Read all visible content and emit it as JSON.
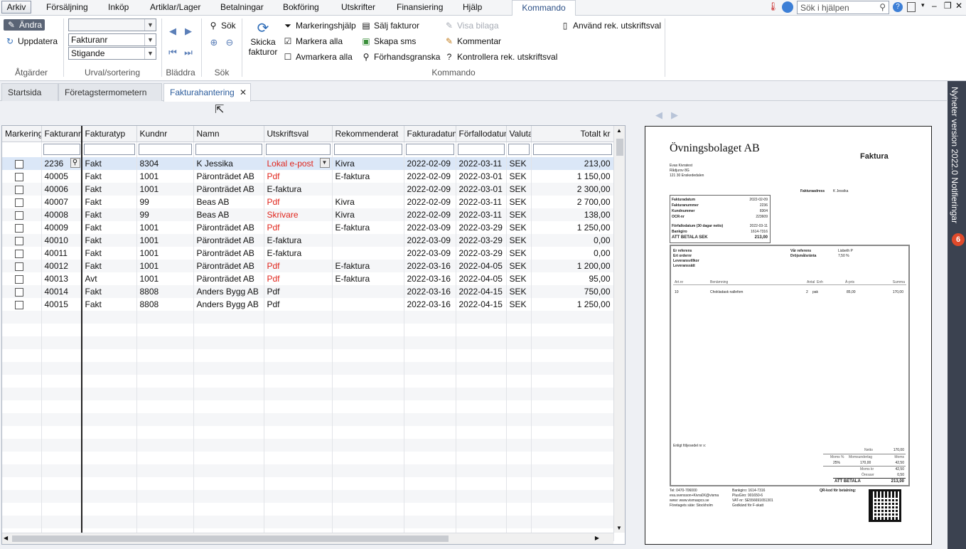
{
  "menubar": {
    "items": [
      "Arkiv",
      "Försäljning",
      "Inköp",
      "Artiklar/Lager",
      "Betalningar",
      "Bokföring",
      "Utskrifter",
      "Finansiering",
      "Hjälp",
      "Kommando"
    ],
    "help_search": "Sök i hjälpen"
  },
  "ribbon": {
    "atgarder": {
      "label": "Åtgärder",
      "andra": "Ändra",
      "uppdatera": "Uppdatera"
    },
    "urval": {
      "label": "Urval/sortering",
      "combo1": "",
      "combo2": "Fakturanr",
      "combo3": "Stigande"
    },
    "bladdra": {
      "label": "Bläddra"
    },
    "sok": {
      "label": "Sök",
      "sok_btn": "Sök"
    },
    "kommando": {
      "label": "Kommando",
      "skicka": "Skicka",
      "fakturor": "fakturor",
      "markeringshjalp": "Markeringshjälp",
      "markera_alla": "Markera alla",
      "avmarkera_alla": "Avmarkera alla",
      "salj_fakturor": "Sälj fakturor",
      "skapa_sms": "Skapa sms",
      "forhandsgranska": "Förhandsgranska",
      "visa_bilaga": "Visa bilaga",
      "kommentar": "Kommentar",
      "kontrollera": "Kontrollera rek. utskriftsval",
      "anvand": "Använd rek. utskriftsval"
    }
  },
  "tabs": [
    "Startsida",
    "Företagstermometern",
    "Fakturahantering"
  ],
  "grid": {
    "columns": [
      "Markering",
      "Fakturanr",
      "Fakturatyp",
      "Kundnr",
      "Namn",
      "Utskriftsval",
      "Rekommenderat",
      "Fakturadatum",
      "Förfallodatum",
      "Valuta",
      "Totalt kr"
    ],
    "rows": [
      {
        "nr": "2236",
        "typ": "Fakt",
        "kund": "8304",
        "namn": "K Jessika",
        "utskr": "Lokal e-post",
        "rek": "Kivra",
        "fdat": "2022-02-09",
        "ffdat": "2022-03-11",
        "val": "SEK",
        "tot": "213,00"
      },
      {
        "nr": "40005",
        "typ": "Fakt",
        "kund": "1001",
        "namn": "Päronträdet AB",
        "utskr": "Pdf",
        "rek": "E-faktura",
        "fdat": "2022-02-09",
        "ffdat": "2022-03-01",
        "val": "SEK",
        "tot": "1 150,00"
      },
      {
        "nr": "40006",
        "typ": "Fakt",
        "kund": "1001",
        "namn": "Päronträdet AB",
        "utskr": "E-faktura",
        "rek": "",
        "fdat": "2022-02-09",
        "ffdat": "2022-03-01",
        "val": "SEK",
        "tot": "2 300,00"
      },
      {
        "nr": "40007",
        "typ": "Fakt",
        "kund": "99",
        "namn": "Beas AB",
        "utskr": "Pdf",
        "rek": "Kivra",
        "fdat": "2022-02-09",
        "ffdat": "2022-03-11",
        "val": "SEK",
        "tot": "2 700,00"
      },
      {
        "nr": "40008",
        "typ": "Fakt",
        "kund": "99",
        "namn": "Beas AB",
        "utskr": "Skrivare",
        "rek": "Kivra",
        "fdat": "2022-02-09",
        "ffdat": "2022-03-11",
        "val": "SEK",
        "tot": "138,00"
      },
      {
        "nr": "40009",
        "typ": "Fakt",
        "kund": "1001",
        "namn": "Päronträdet AB",
        "utskr": "Pdf",
        "rek": "E-faktura",
        "fdat": "2022-03-09",
        "ffdat": "2022-03-29",
        "val": "SEK",
        "tot": "1 250,00"
      },
      {
        "nr": "40010",
        "typ": "Fakt",
        "kund": "1001",
        "namn": "Päronträdet AB",
        "utskr": "E-faktura",
        "rek": "",
        "fdat": "2022-03-09",
        "ffdat": "2022-03-29",
        "val": "SEK",
        "tot": "0,00"
      },
      {
        "nr": "40011",
        "typ": "Fakt",
        "kund": "1001",
        "namn": "Päronträdet AB",
        "utskr": "E-faktura",
        "rek": "",
        "fdat": "2022-03-09",
        "ffdat": "2022-03-29",
        "val": "SEK",
        "tot": "0,00"
      },
      {
        "nr": "40012",
        "typ": "Fakt",
        "kund": "1001",
        "namn": "Päronträdet AB",
        "utskr": "Pdf",
        "rek": "E-faktura",
        "fdat": "2022-03-16",
        "ffdat": "2022-04-05",
        "val": "SEK",
        "tot": "1 200,00"
      },
      {
        "nr": "40013",
        "typ": "Avt",
        "kund": "1001",
        "namn": "Päronträdet AB",
        "utskr": "Pdf",
        "rek": "E-faktura",
        "fdat": "2022-03-16",
        "ffdat": "2022-04-05",
        "val": "SEK",
        "tot": "95,00"
      },
      {
        "nr": "40014",
        "typ": "Fakt",
        "kund": "8808",
        "namn": "Anders Bygg AB",
        "utskr": "Pdf",
        "rek": "",
        "fdat": "2022-03-16",
        "ffdat": "2022-04-15",
        "val": "SEK",
        "tot": "750,00"
      },
      {
        "nr": "40015",
        "typ": "Fakt",
        "kund": "8808",
        "namn": "Anders Bygg AB",
        "utskr": "Pdf",
        "rek": "",
        "fdat": "2022-03-16",
        "ffdat": "2022-04-15",
        "val": "SEK",
        "tot": "1 250,00"
      }
    ]
  },
  "preview": {
    "company": "Övningsbolaget AB",
    "doc_title": "Faktura",
    "sender": [
      "Evas Kivratest",
      "Rådjursv 8G",
      "121 30 Enskededalen"
    ],
    "fakturaadress_label": "Fakturaadress",
    "fakturaadress": "K Jessika",
    "info": [
      [
        "Fakturadatum",
        "2022-02-09"
      ],
      [
        "Fakturanummer",
        "2236"
      ],
      [
        "Kundnummer",
        "8304"
      ],
      [
        "OCR-nr",
        "223609"
      ]
    ],
    "forfall": [
      [
        "Förfallodatum (30 dagar netto)",
        "2022-03-11"
      ],
      [
        "Bankgiro",
        "1614-7316"
      ]
    ],
    "att_betala_label": "ATT BETALA SEK",
    "att_betala": "213,00",
    "ref_left": [
      "Er referens",
      "Ert ordernr",
      "Leveransvillkor",
      "Leveranssätt"
    ],
    "ref_right": [
      [
        "Vår referens",
        "Lisbeth P"
      ],
      [
        "Dröjsmålsränta",
        "7,50 %"
      ]
    ],
    "row_headers": [
      "Art.nr",
      "Benämning",
      "Antal",
      "Enh",
      "À-pris",
      "Summa"
    ],
    "row": [
      "10",
      "Chokladask nallefom",
      "2",
      "pak",
      "85,00",
      "170,00"
    ],
    "enligt": "Enligt följesedel nr x:",
    "sum_netto_label": "Netto",
    "sum_netto": "170,00",
    "moms_headers": [
      "Moms %",
      "Momsunderlag",
      "Moms"
    ],
    "moms_row": [
      "25%",
      "170,00",
      "42,50"
    ],
    "moms_label": "Moms kr",
    "moms": "42,50",
    "oresavr_label": "Öresavr",
    "oresavr": "0,50",
    "total_label": "ATT BETALA",
    "total": "213,00",
    "footer1": [
      "Tel: 0470-706000",
      "eva.svensson+Kivra0X@visma",
      "www: www.vismaspcs.se",
      "Företagets säte: Stockholm"
    ],
    "footer2": [
      "Bankgiro: 1614-7316",
      "PlusGiro: 901650-6",
      "VAT-nr: SE556691651301",
      "Godkänd för F-skatt"
    ],
    "qr_label": "QR-kod för betalning:"
  },
  "side": {
    "text": "Nyheter version 2022.0   Notifieringar",
    "badge": "6"
  }
}
